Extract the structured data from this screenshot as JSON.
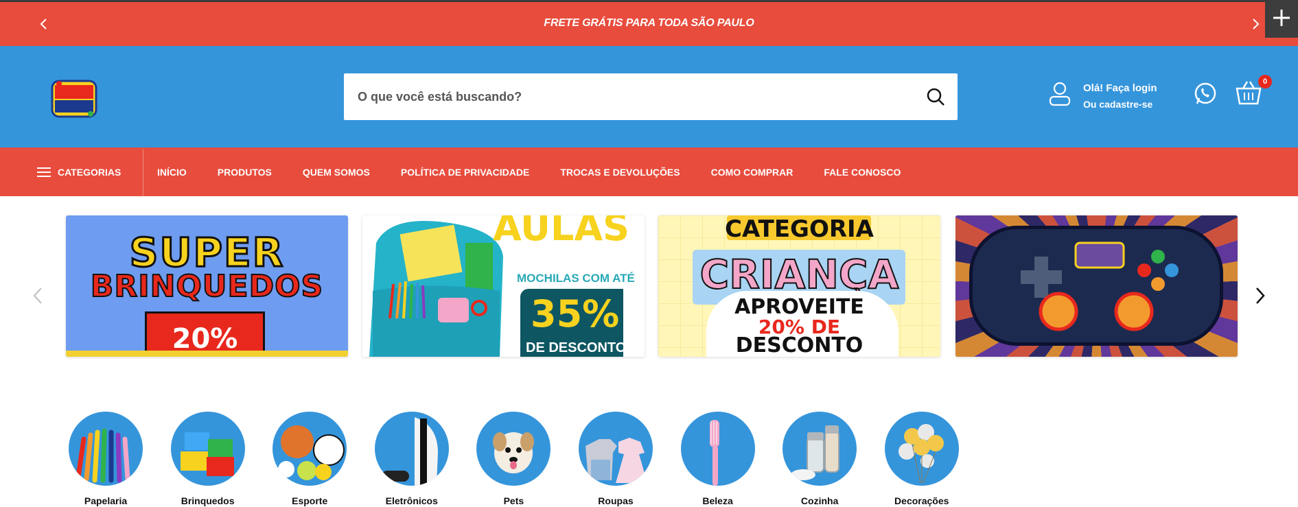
{
  "announcement": {
    "text": "FRETE GRÁTIS PARA TODA SÃO PAULO"
  },
  "header": {
    "search_placeholder": "O que você está buscando?",
    "login_line1": "Olá! Faça login",
    "login_line2": "Ou cadastre-se",
    "cart_count": "0"
  },
  "nav": {
    "categories_label": "CATEGORIAS",
    "items": [
      "INÍCIO",
      "PRODUTOS",
      "QUEM SOMOS",
      "POLÍTICA DE PRIVACIDADE",
      "TROCAS E DEVOLUÇÕES",
      "COMO COMPRAR",
      "FALE CONOSCO"
    ]
  },
  "banners": {
    "b1": {
      "line1": "SUPER",
      "line2": "BRINQUEDOS",
      "discount": "20%"
    },
    "b2": {
      "title": "AULAS",
      "subtitle": "MOCHILAS COM ATÉ",
      "discount": "35%",
      "desc": "DE DESCONTO"
    },
    "b3": {
      "title": "CATEGORIA",
      "headline": "CRIANÇA",
      "line1": "APROVEITE",
      "line2": "20% DE",
      "line3": "DESCONTO"
    }
  },
  "categories": [
    "Papelaria",
    "Brinquedos",
    "Esporte",
    "Eletrônicos",
    "Pets",
    "Roupas",
    "Beleza",
    "Cozinha",
    "Decorações"
  ],
  "colors": {
    "announcement_bg": "#e84c3d",
    "header_bg": "#3595db",
    "nav_bg": "#e84c3d",
    "category_circle": "#3595db"
  }
}
